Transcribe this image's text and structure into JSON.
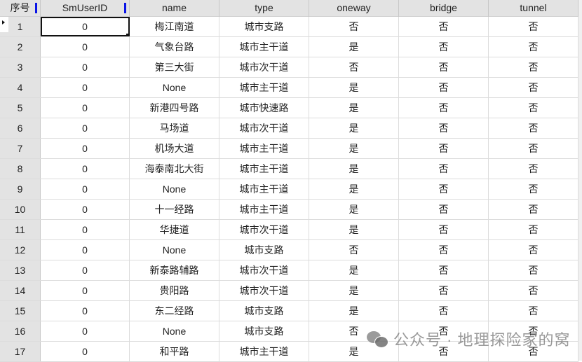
{
  "table": {
    "columns": [
      "序号",
      "SmUserID",
      "name",
      "type",
      "oneway",
      "bridge",
      "tunnel"
    ],
    "sorted_columns": [
      "序号",
      "SmUserID"
    ],
    "active_cell": {
      "row": 1,
      "column": "SmUserID"
    },
    "current_row_indicator": "row-pointer-icon",
    "rows": [
      {
        "idx": "1",
        "smuserid": "0",
        "name": "梅江南道",
        "type": "城市支路",
        "oneway": "否",
        "bridge": "否",
        "tunnel": "否"
      },
      {
        "idx": "2",
        "smuserid": "0",
        "name": "气象台路",
        "type": "城市主干道",
        "oneway": "是",
        "bridge": "否",
        "tunnel": "否"
      },
      {
        "idx": "3",
        "smuserid": "0",
        "name": "第三大街",
        "type": "城市次干道",
        "oneway": "否",
        "bridge": "否",
        "tunnel": "否"
      },
      {
        "idx": "4",
        "smuserid": "0",
        "name": "None",
        "type": "城市主干道",
        "oneway": "是",
        "bridge": "否",
        "tunnel": "否"
      },
      {
        "idx": "5",
        "smuserid": "0",
        "name": "新港四号路",
        "type": "城市快速路",
        "oneway": "是",
        "bridge": "否",
        "tunnel": "否"
      },
      {
        "idx": "6",
        "smuserid": "0",
        "name": "马场道",
        "type": "城市次干道",
        "oneway": "是",
        "bridge": "否",
        "tunnel": "否"
      },
      {
        "idx": "7",
        "smuserid": "0",
        "name": "机场大道",
        "type": "城市主干道",
        "oneway": "是",
        "bridge": "否",
        "tunnel": "否"
      },
      {
        "idx": "8",
        "smuserid": "0",
        "name": "海泰南北大街",
        "type": "城市主干道",
        "oneway": "是",
        "bridge": "否",
        "tunnel": "否"
      },
      {
        "idx": "9",
        "smuserid": "0",
        "name": "None",
        "type": "城市主干道",
        "oneway": "是",
        "bridge": "否",
        "tunnel": "否"
      },
      {
        "idx": "10",
        "smuserid": "0",
        "name": "十一经路",
        "type": "城市主干道",
        "oneway": "是",
        "bridge": "否",
        "tunnel": "否"
      },
      {
        "idx": "11",
        "smuserid": "0",
        "name": "华捷道",
        "type": "城市次干道",
        "oneway": "是",
        "bridge": "否",
        "tunnel": "否"
      },
      {
        "idx": "12",
        "smuserid": "0",
        "name": "None",
        "type": "城市支路",
        "oneway": "否",
        "bridge": "否",
        "tunnel": "否"
      },
      {
        "idx": "13",
        "smuserid": "0",
        "name": "新泰路辅路",
        "type": "城市次干道",
        "oneway": "是",
        "bridge": "否",
        "tunnel": "否"
      },
      {
        "idx": "14",
        "smuserid": "0",
        "name": "贵阳路",
        "type": "城市次干道",
        "oneway": "是",
        "bridge": "否",
        "tunnel": "否"
      },
      {
        "idx": "15",
        "smuserid": "0",
        "name": "东二经路",
        "type": "城市支路",
        "oneway": "是",
        "bridge": "否",
        "tunnel": "否"
      },
      {
        "idx": "16",
        "smuserid": "0",
        "name": "None",
        "type": "城市支路",
        "oneway": "否",
        "bridge": "否",
        "tunnel": "否"
      },
      {
        "idx": "17",
        "smuserid": "0",
        "name": "和平路",
        "type": "城市主干道",
        "oneway": "是",
        "bridge": "否",
        "tunnel": "否"
      }
    ]
  },
  "watermark": {
    "icon": "wechat-icon",
    "text": "公众号 · 地理探险家的窝"
  },
  "colors": {
    "header_bg": "#e3e3e3",
    "sort_marker": "#0a14e6",
    "grid_line": "#dcdcdc"
  }
}
